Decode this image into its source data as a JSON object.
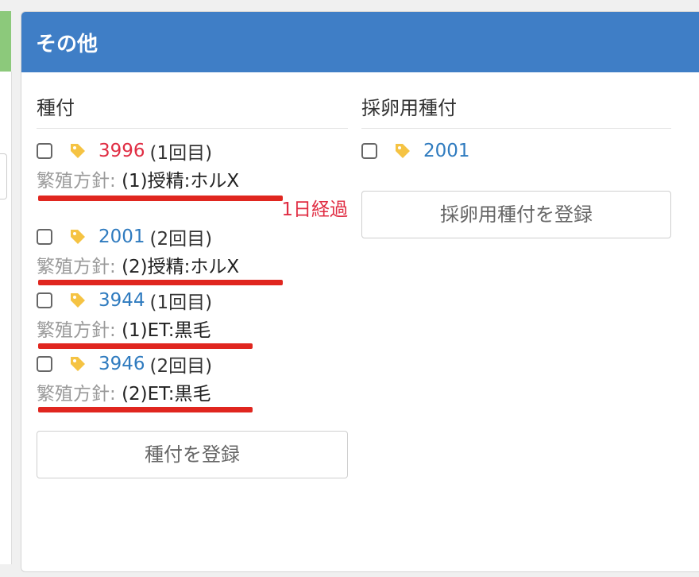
{
  "panel": {
    "title": "その他"
  },
  "breeding": {
    "title": "種付",
    "entries": [
      {
        "number": "3996",
        "round": "(1回目)",
        "number_color": "#e02d43",
        "policy_label": "繁殖方針:",
        "policy_value": "(1)授精:ホルX",
        "elapsed": "1日経過"
      },
      {
        "number": "2001",
        "round": "(2回目)",
        "number_color": "#2f7bbf",
        "policy_label": "繁殖方針:",
        "policy_value": "(2)授精:ホルX"
      },
      {
        "number": "3944",
        "round": "(1回目)",
        "number_color": "#2f7bbf",
        "policy_label": "繁殖方針:",
        "policy_value": "(1)ET:黒毛"
      },
      {
        "number": "3946",
        "round": "(2回目)",
        "number_color": "#2f7bbf",
        "policy_label": "繁殖方針:",
        "policy_value": "(2)ET:黒毛"
      }
    ],
    "register_button": "種付を登録"
  },
  "egg_collection": {
    "title": "採卵用種付",
    "entries": [
      {
        "number": "2001",
        "number_color": "#2f7bbf"
      }
    ],
    "register_button": "採卵用種付を登録"
  },
  "icons": {
    "tag": "tag-icon",
    "checkbox": "checkbox"
  },
  "colors": {
    "header": "#3f7ec6",
    "highlight_underline": "#e0261f",
    "tag": "#f5c343"
  }
}
